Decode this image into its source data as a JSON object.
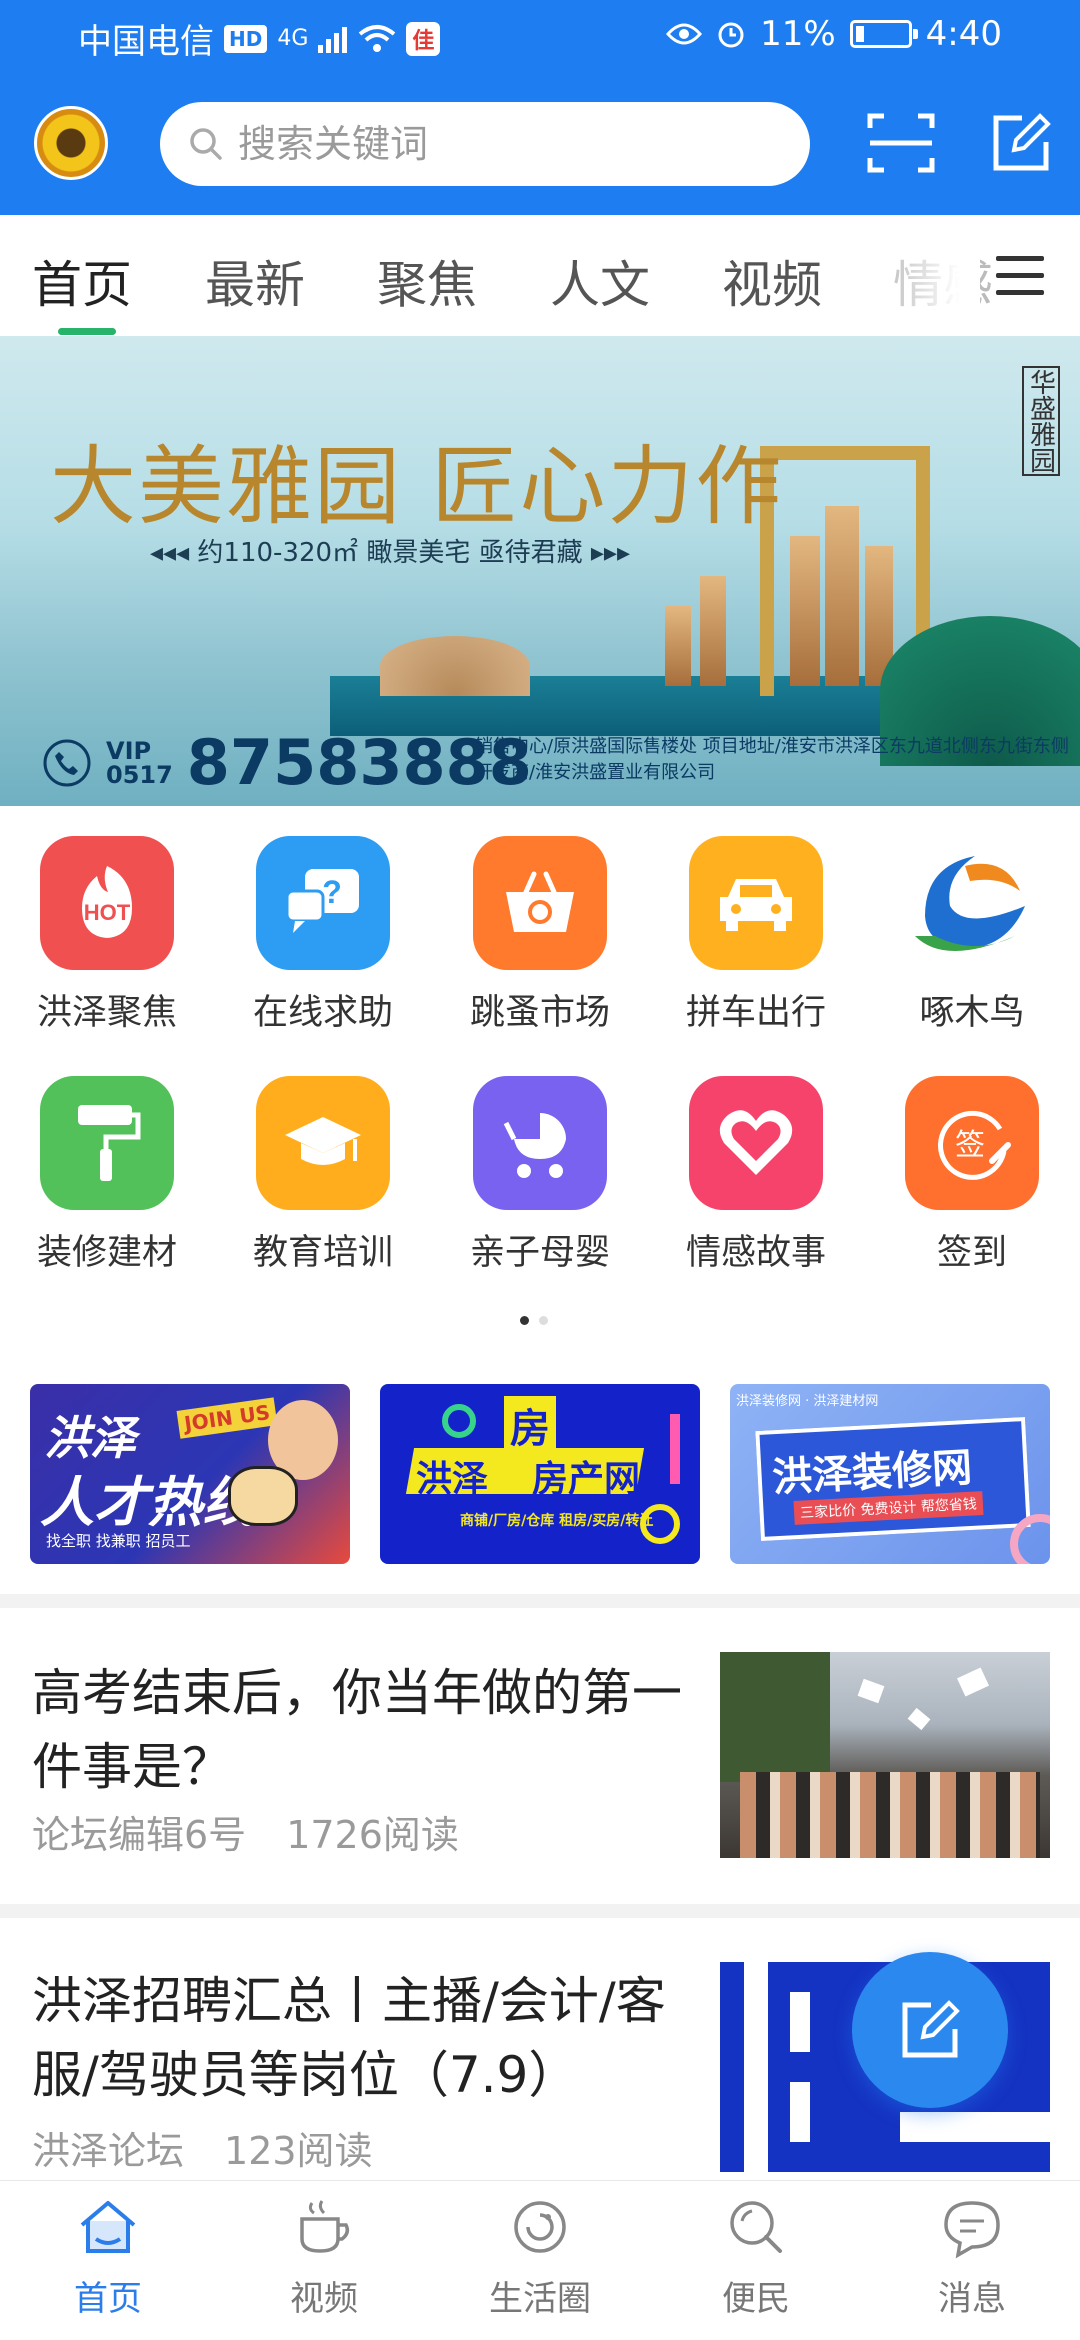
{
  "status_bar": {
    "carrier": "中国电信",
    "hd": "HD",
    "network": "4G",
    "battery": "11%",
    "time": "4:40"
  },
  "header": {
    "search_placeholder": "搜索关键词"
  },
  "tabs": [
    "首页",
    "最新",
    "聚焦",
    "人文",
    "视频",
    "情感"
  ],
  "banner": {
    "title": "大美雅园  匠心力作",
    "subtitle": "◂◂◂  约110-320㎡ 瞰景美宅 亟待君藏  ▸▸▸",
    "vip_label": "VIP",
    "area_code": "0517",
    "phone": "87583888",
    "info_line1": "销售中心/原洪盛国际售楼处  项目地址/淮安市洪泽区东九道北侧东九街东侧",
    "info_line2": "开发商/淮安洪盛置业有限公司",
    "seal": "华盛雅园"
  },
  "grid": [
    {
      "label": "洪泽聚焦",
      "icon": "hot-icon",
      "color": "#f0504f"
    },
    {
      "label": "在线求助",
      "icon": "help-chat-icon",
      "color": "#2d9cf3"
    },
    {
      "label": "跳蚤市场",
      "icon": "basket-icon",
      "color": "#ff7a2c"
    },
    {
      "label": "拼车出行",
      "icon": "car-icon",
      "color": "#ffb01f"
    },
    {
      "label": "啄木鸟",
      "icon": "woodpecker-logo-icon",
      "color": "#1e6fd0"
    },
    {
      "label": "装修建材",
      "icon": "paint-roller-icon",
      "color": "#52c15a"
    },
    {
      "label": "教育培训",
      "icon": "graduation-cap-icon",
      "color": "#ffad1c"
    },
    {
      "label": "亲子母婴",
      "icon": "baby-stroller-icon",
      "color": "#7a62f0"
    },
    {
      "label": "情感故事",
      "icon": "heart-icon",
      "color": "#f5436b"
    },
    {
      "label": "签到",
      "icon": "sign-in-icon",
      "color": "#ff6f2e"
    }
  ],
  "promos": [
    {
      "title_1": "洪泽",
      "title_2": "人才热线",
      "tag": "JOIN US",
      "foot": "找全职   找兼职   招员工"
    },
    {
      "title_1": "洪泽",
      "title_2": "房产网",
      "tag": "房",
      "foot": "商铺/厂房/仓库     租房/买房/转让"
    },
    {
      "title_1": "洪泽装修网",
      "tag": "洪泽装修网 · 洪泽建材网",
      "foot": "三家比价  免费设计  帮您省钱"
    }
  ],
  "news": [
    {
      "title": "高考结束后，你当年做的第一件事是？",
      "author": "论坛编辑6号",
      "reads": "1726阅读"
    },
    {
      "title": "洪泽招聘汇总丨主播/会计/客服/驾驶员等岗位（7.9）",
      "author": "洪泽论坛",
      "reads": "123阅读"
    }
  ],
  "bottom_nav": [
    {
      "label": "首页",
      "icon": "home-icon"
    },
    {
      "label": "视频",
      "icon": "coffee-cup-icon"
    },
    {
      "label": "生活圈",
      "icon": "life-circle-icon"
    },
    {
      "label": "便民",
      "icon": "search-icon"
    },
    {
      "label": "消息",
      "icon": "message-bubble-icon"
    }
  ]
}
